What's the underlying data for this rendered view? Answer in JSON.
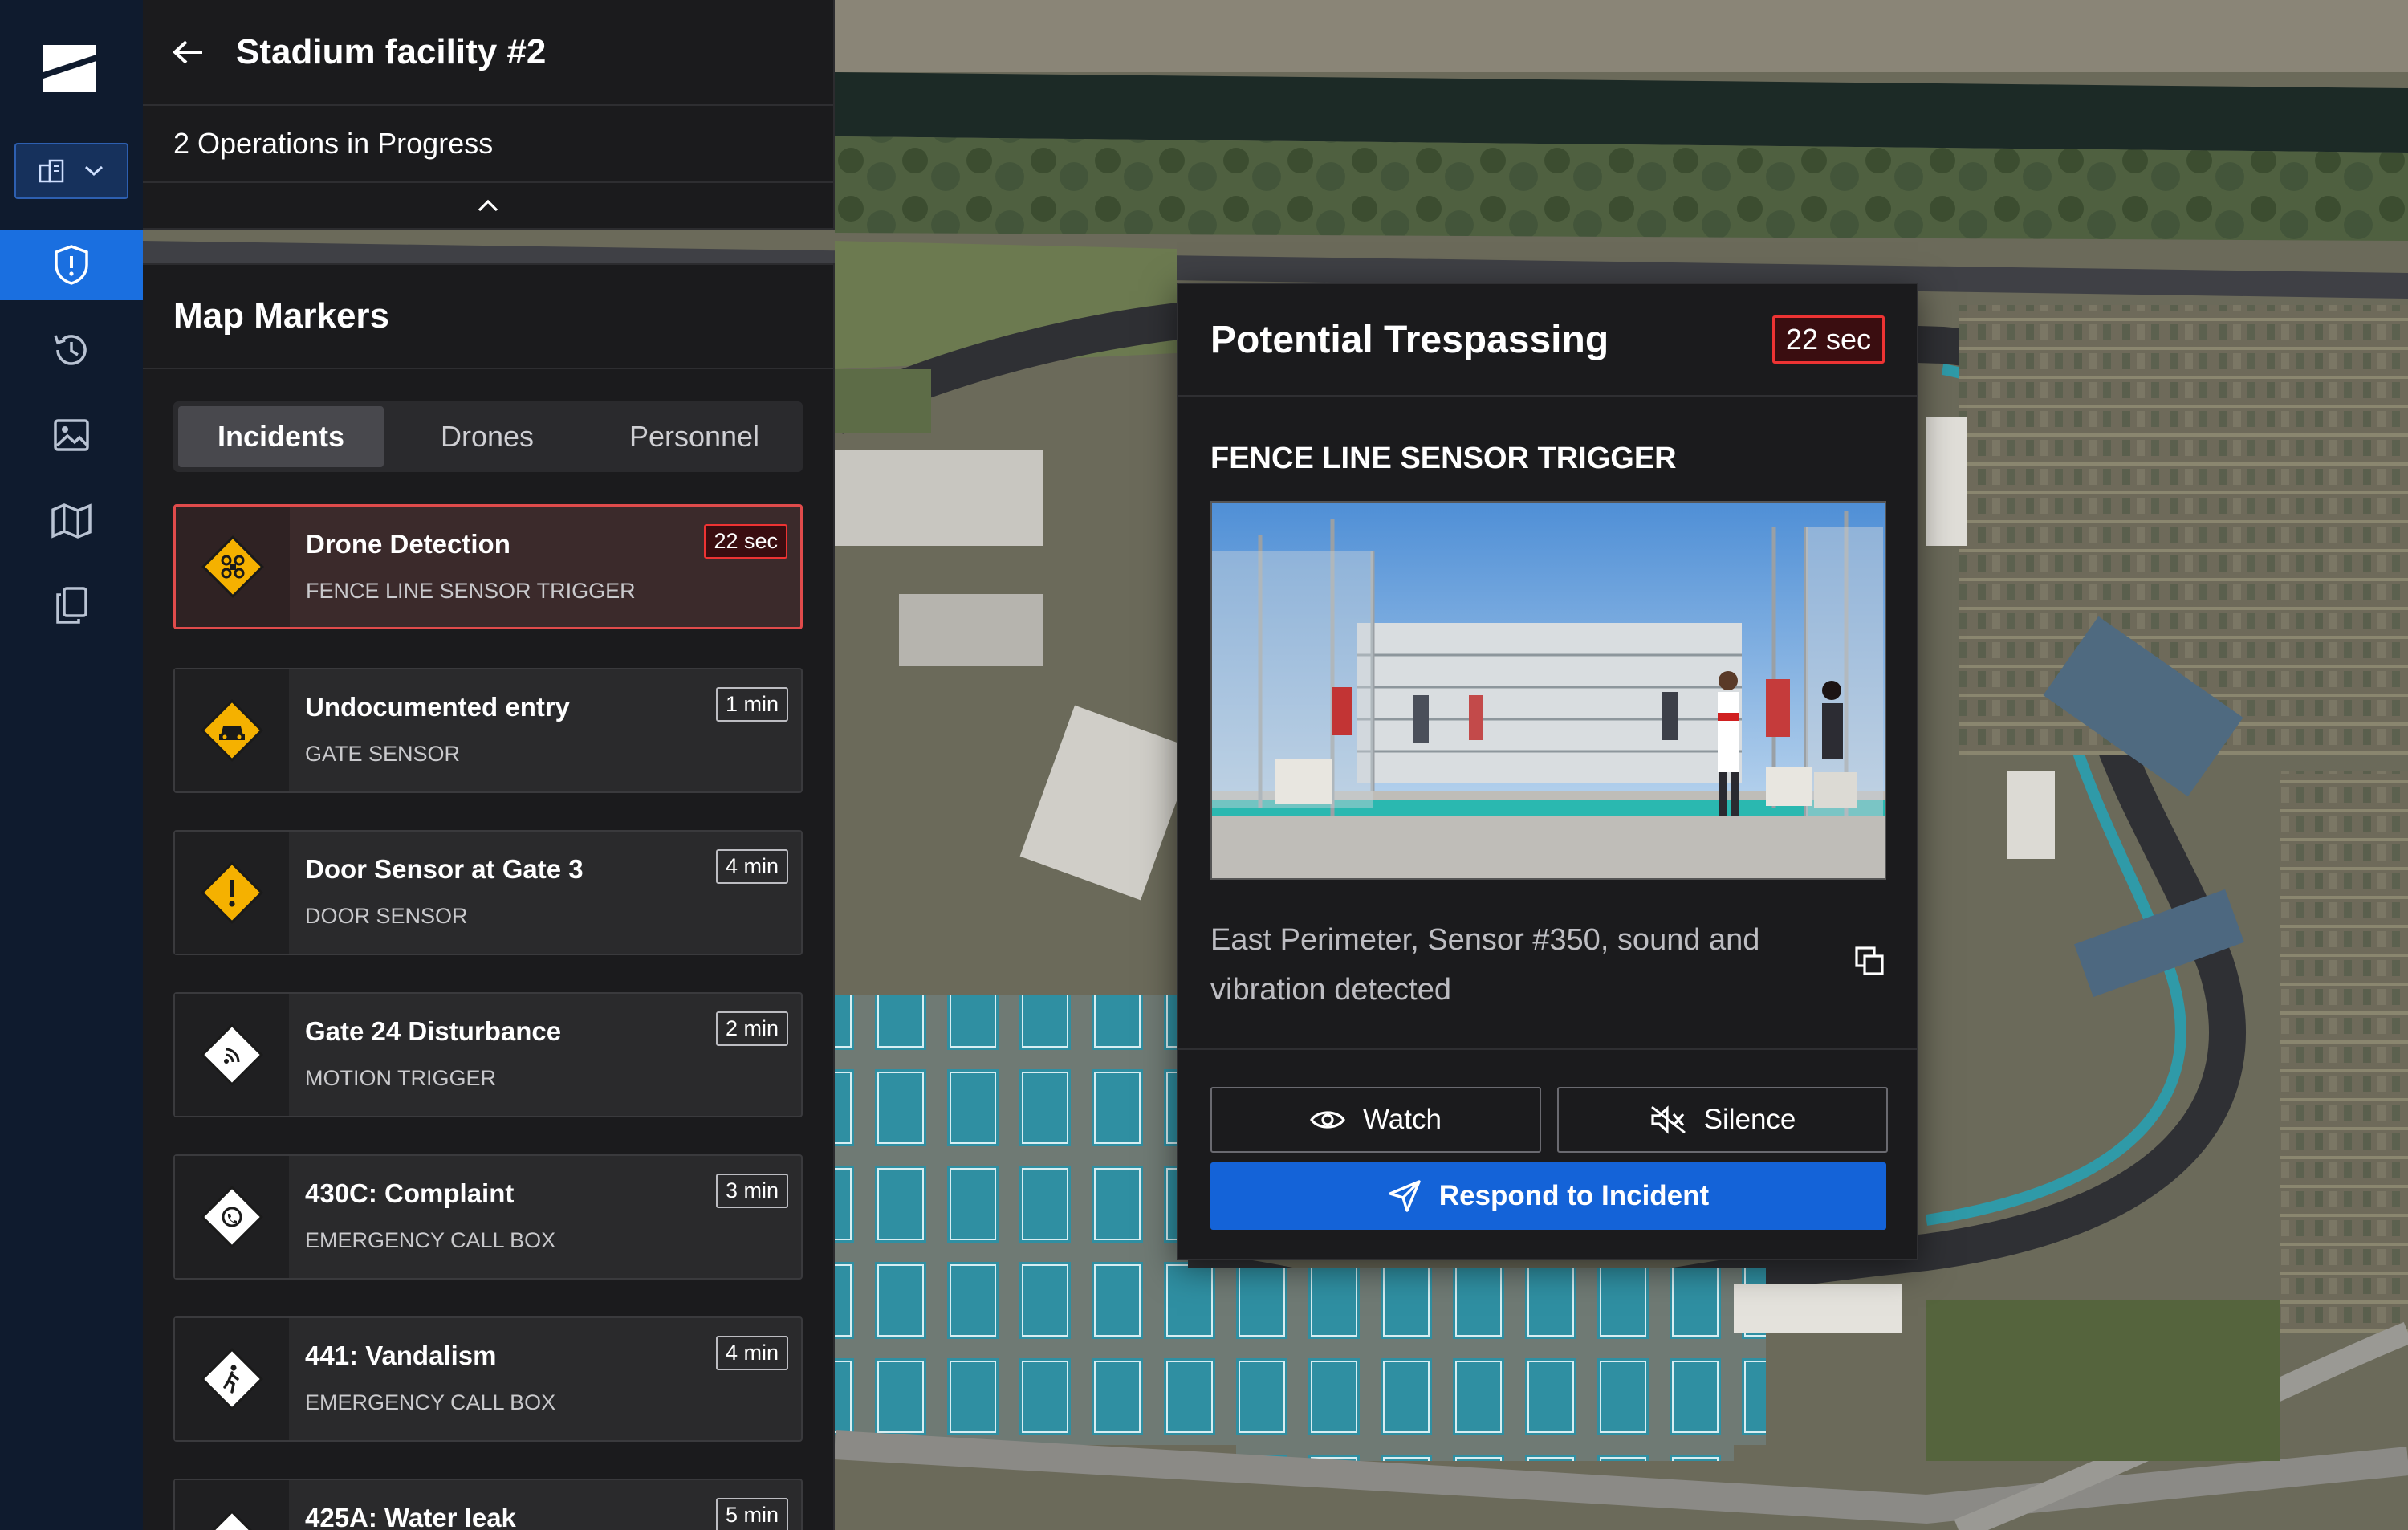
{
  "rail": {
    "items": [
      "incidents",
      "history",
      "media",
      "map",
      "reports"
    ]
  },
  "operations": {
    "title": "Stadium facility #2",
    "summary": "2 Operations in Progress"
  },
  "markers": {
    "title": "Map Markers",
    "tabs": [
      "Incidents",
      "Drones",
      "Personnel"
    ],
    "active_tab": "Incidents",
    "incidents": [
      {
        "name": "Drone Detection",
        "source": "FENCE LINE SENSOR TRIGGER",
        "time": "22 sec",
        "icon": "drone-icon",
        "color": "#f5b100",
        "selected": true
      },
      {
        "name": "Undocumented entry",
        "source": "GATE SENSOR",
        "time": "1 min",
        "icon": "car-icon",
        "color": "#f5b100"
      },
      {
        "name": "Door Sensor at Gate 3",
        "source": "DOOR SENSOR",
        "time": "4 min",
        "icon": "exclamation-icon",
        "color": "#f5b100"
      },
      {
        "name": "Gate 24  Disturbance",
        "source": "MOTION TRIGGER",
        "time": "2 min",
        "icon": "signal-icon",
        "color": "#ffffff"
      },
      {
        "name": "430C: Complaint",
        "source": "EMERGENCY CALL BOX",
        "time": "3 min",
        "icon": "phone-icon",
        "color": "#ffffff"
      },
      {
        "name": "441: Vandalism",
        "source": "EMERGENCY CALL BOX",
        "time": "4 min",
        "icon": "person-icon",
        "color": "#ffffff"
      },
      {
        "name": "425A: Water leak",
        "source": "",
        "time": "5 min",
        "icon": "water-icon",
        "color": "#ffffff"
      }
    ]
  },
  "alert": {
    "title": "Potential Trespassing",
    "timer": "22 sec",
    "section": "FENCE LINE SENSOR TRIGGER",
    "description": "East Perimeter, Sensor #350, sound and vibration detected",
    "watch_label": "Watch",
    "silence_label": "Silence",
    "respond_label": "Respond to Incident"
  },
  "colors": {
    "accent": "#1a6fe0",
    "alert_red": "#e33333",
    "warning_yellow": "#f5b100"
  }
}
